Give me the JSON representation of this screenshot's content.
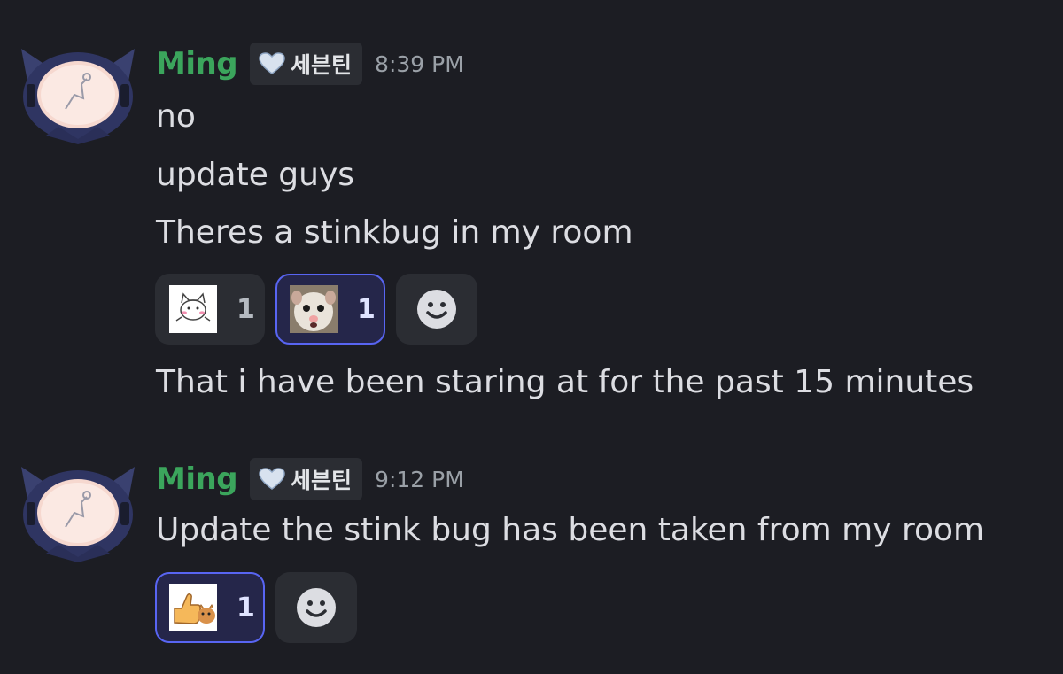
{
  "colors": {
    "background": "#1c1d23",
    "username": "#3ba55c",
    "active_reaction_border": "#5865f2"
  },
  "messages": [
    {
      "author": "Ming",
      "role_tag": "세븐틴",
      "role_icon": "heart-icon",
      "timestamp": "8:39 PM",
      "lines": [
        "no",
        "update guys",
        "Theres a stinkbug in my room"
      ],
      "reactions": [
        {
          "emoji": "cat-sticker-emoji",
          "count": "1",
          "active": false
        },
        {
          "emoji": "hamster-face-emoji",
          "count": "1",
          "active": true
        }
      ],
      "after_reactions": [
        "That i have been staring at for the past 15 minutes"
      ]
    },
    {
      "author": "Ming",
      "role_tag": "세븐틴",
      "role_icon": "heart-icon",
      "timestamp": "9:12 PM",
      "lines": [
        "Update the stink bug has been taken from my room"
      ],
      "reactions": [
        {
          "emoji": "thumbs-up-animal-emoji",
          "count": "1",
          "active": true
        }
      ]
    }
  ]
}
